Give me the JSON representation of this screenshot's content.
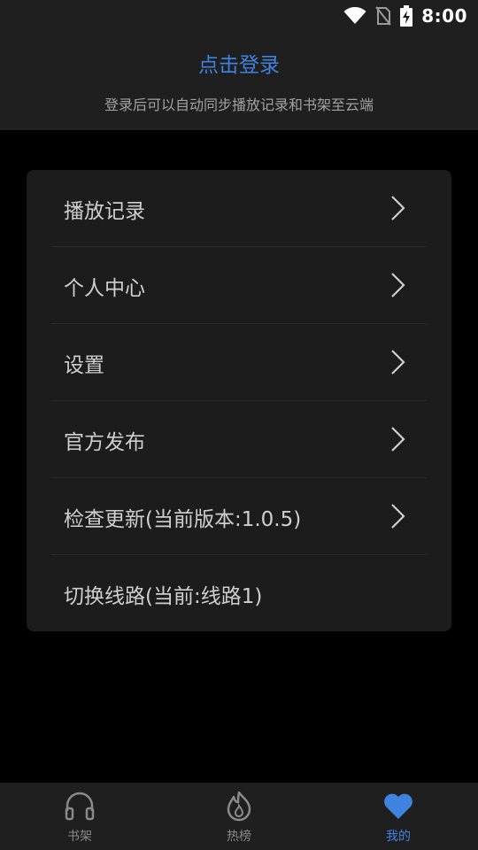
{
  "status_bar": {
    "time": "8:00"
  },
  "header": {
    "login_label": "点击登录",
    "subtitle": "登录后可以自动同步播放记录和书架至云端"
  },
  "menu": {
    "items": [
      {
        "label": "播放记录",
        "has_chevron": true
      },
      {
        "label": "个人中心",
        "has_chevron": true
      },
      {
        "label": "设置",
        "has_chevron": true
      },
      {
        "label": "官方发布",
        "has_chevron": true
      },
      {
        "label": "检查更新(当前版本:1.0.5)",
        "has_chevron": true
      },
      {
        "label": "切换线路(当前:线路1)",
        "has_chevron": false
      }
    ]
  },
  "tab_bar": {
    "tabs": [
      {
        "label": "书架",
        "icon": "headphones-icon",
        "active": false
      },
      {
        "label": "热榜",
        "icon": "flame-icon",
        "active": false
      },
      {
        "label": "我的",
        "icon": "heart-icon",
        "active": true
      }
    ]
  },
  "colors": {
    "accent": "#3f83e0",
    "background": "#000000",
    "surface": "#1f1f1f",
    "card": "#1c1c1c"
  }
}
